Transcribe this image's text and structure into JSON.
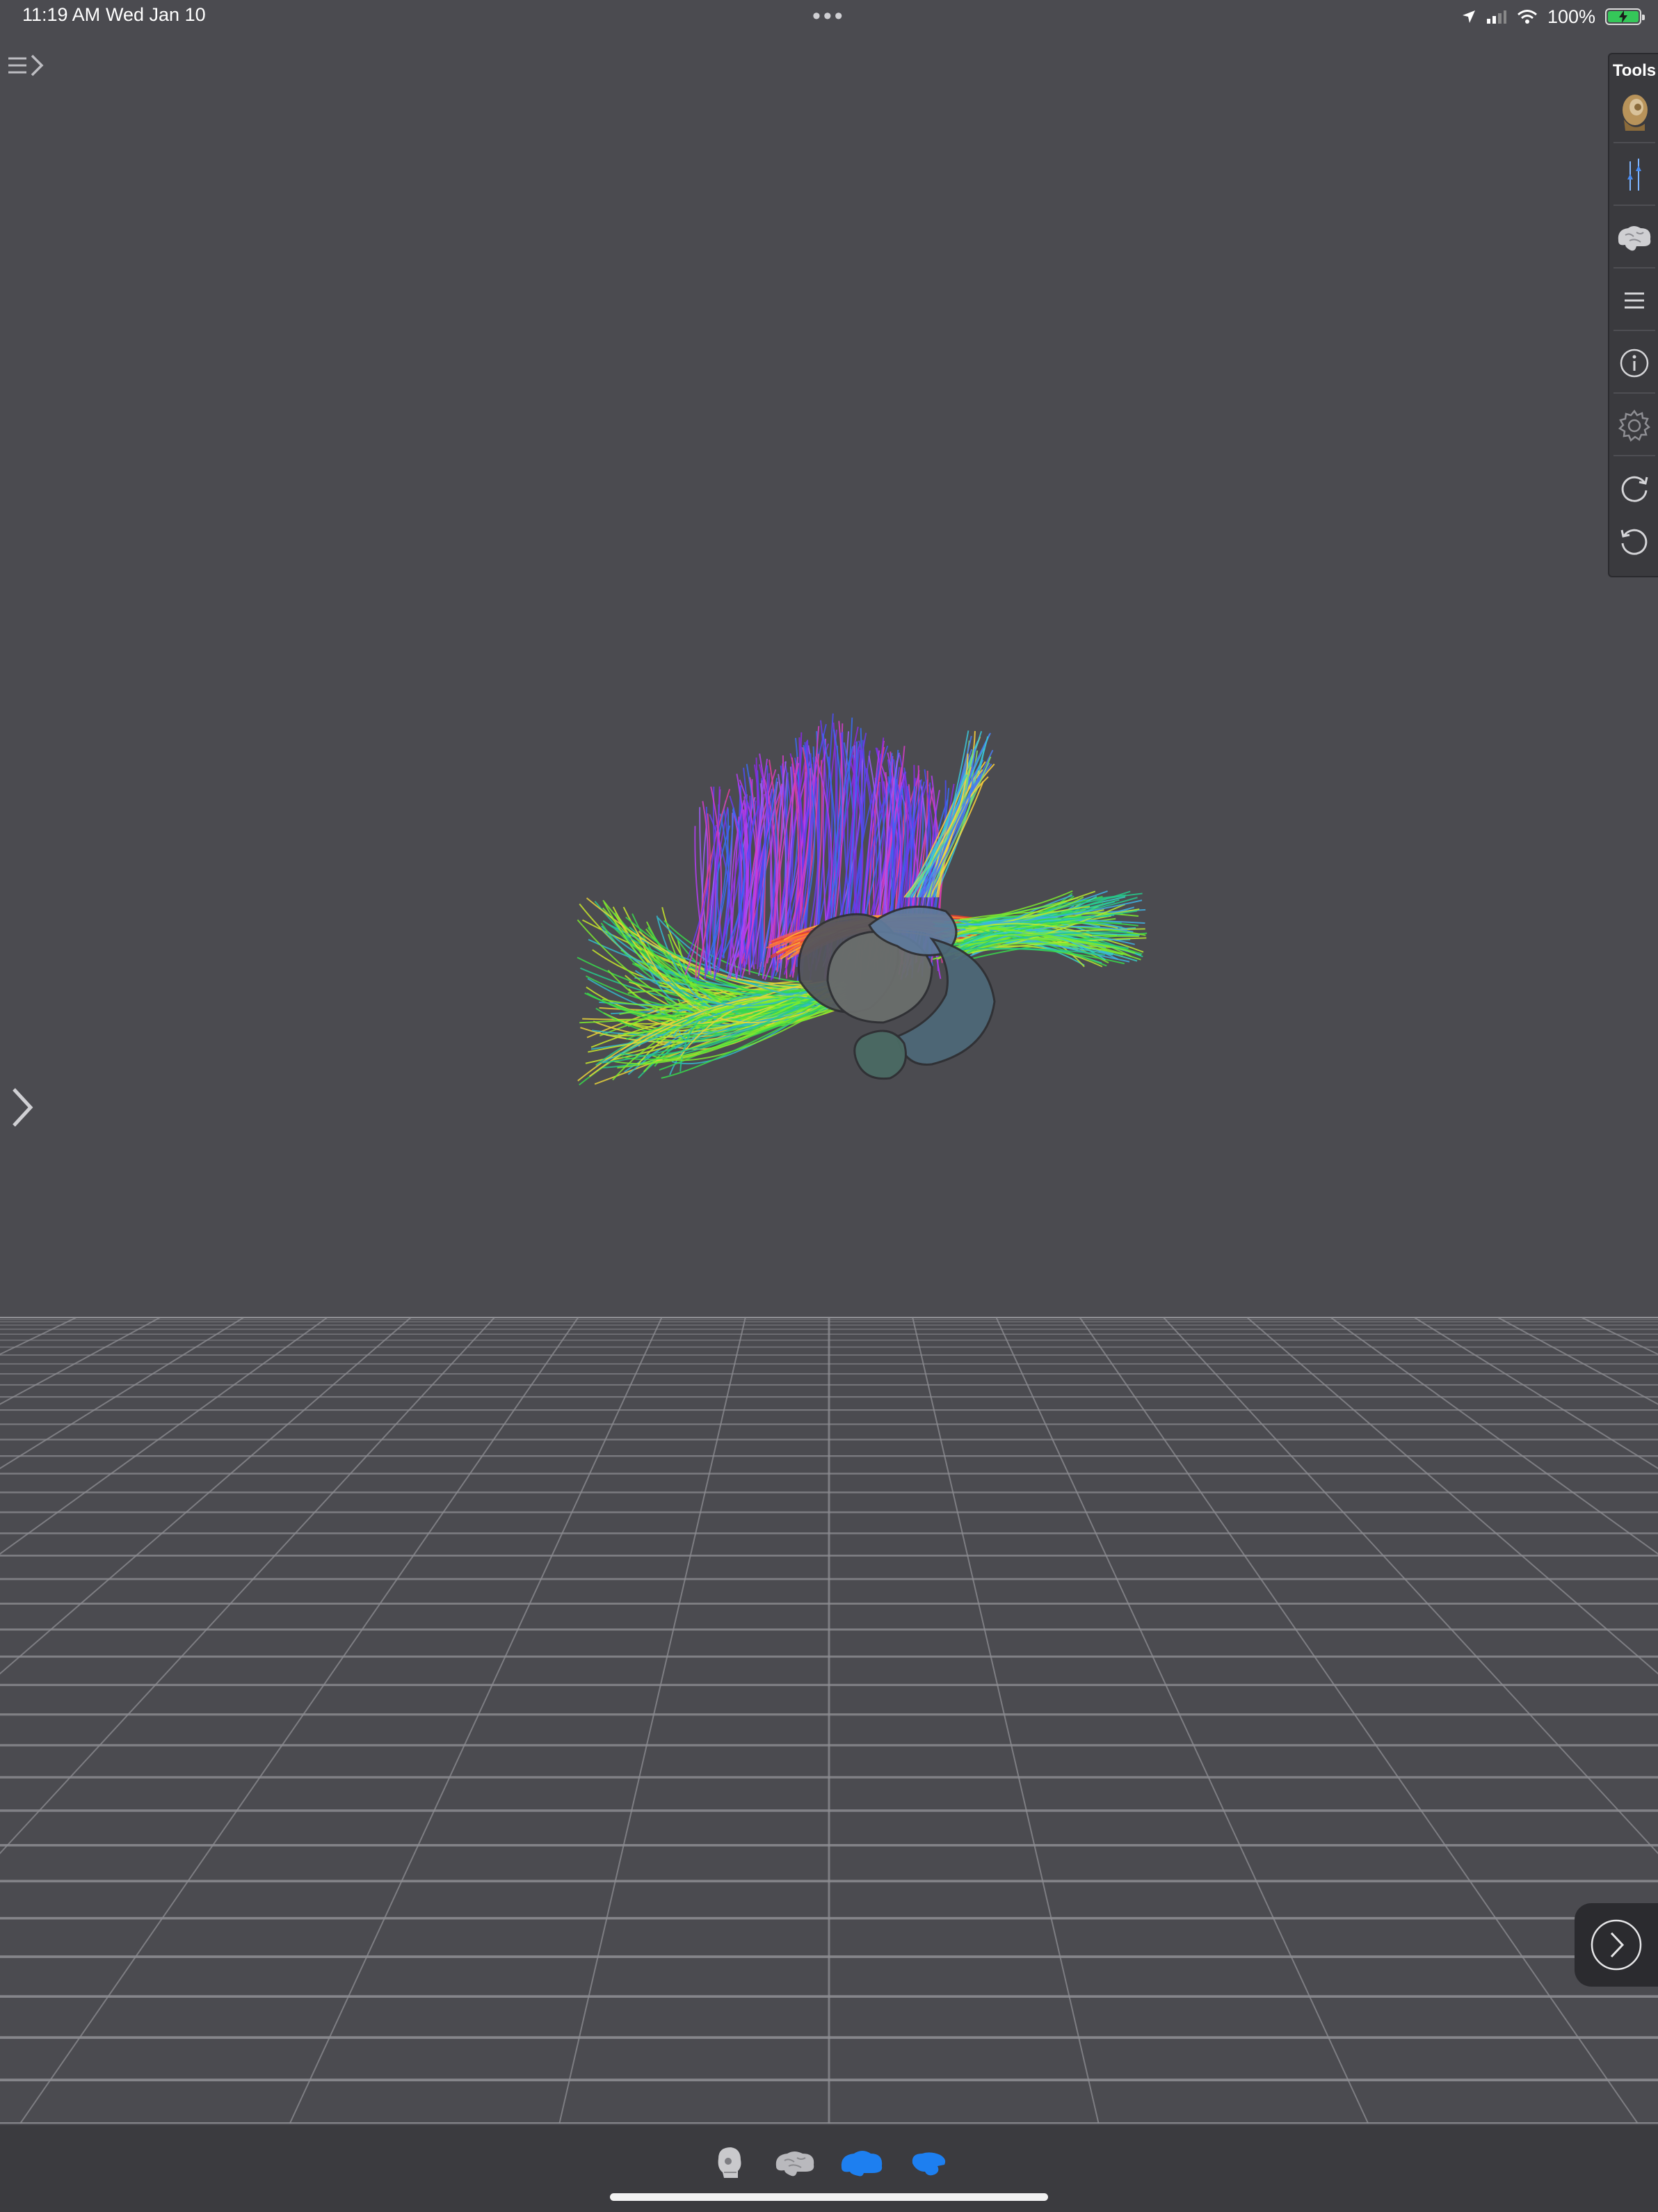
{
  "status_bar": {
    "time": "11:19 AM",
    "date": "Wed Jan 10",
    "battery_text": "100%",
    "battery_level": 1.0,
    "icons": [
      "location-icon",
      "cellular-signal-icon",
      "wifi-icon",
      "battery-charging-icon"
    ]
  },
  "toolbar": {
    "menu_icon": "menu-expand-icon",
    "left_panel_icon": "chevron-right-icon"
  },
  "tools_panel": {
    "title": "Tools",
    "items": [
      {
        "name": "head-model",
        "icon": "head-model-icon"
      },
      {
        "name": "sliders",
        "icon": "sliders-icon"
      },
      {
        "name": "brain",
        "icon": "brain-icon"
      },
      {
        "name": "list",
        "icon": "list-icon"
      },
      {
        "name": "info",
        "icon": "info-icon"
      },
      {
        "name": "settings",
        "icon": "gear-icon"
      },
      {
        "name": "rotate-clockwise",
        "icon": "rotate-cw-icon"
      },
      {
        "name": "rotate-counterclockwise",
        "icon": "rotate-ccw-icon"
      }
    ]
  },
  "viewport": {
    "subject": "fiber-tractography-brain",
    "floor": "perspective-grid"
  },
  "next_button": {
    "icon": "chevron-right-circle-icon"
  },
  "bottom_bar": {
    "views": [
      {
        "name": "skull-view",
        "icon": "skull-icon",
        "active": false
      },
      {
        "name": "brain-view",
        "icon": "brain-icon",
        "active": false
      },
      {
        "name": "hemisphere-view",
        "icon": "brain-hemisphere-icon",
        "active": true
      },
      {
        "name": "half-brain-view",
        "icon": "brain-half-icon",
        "active": true
      }
    ]
  },
  "colors": {
    "background": "#4b4b50",
    "panel": "#3a3a3e",
    "accent_blue": "#1d7ff0",
    "grid_line": "#8e8e93",
    "battery_green": "#35c759"
  }
}
